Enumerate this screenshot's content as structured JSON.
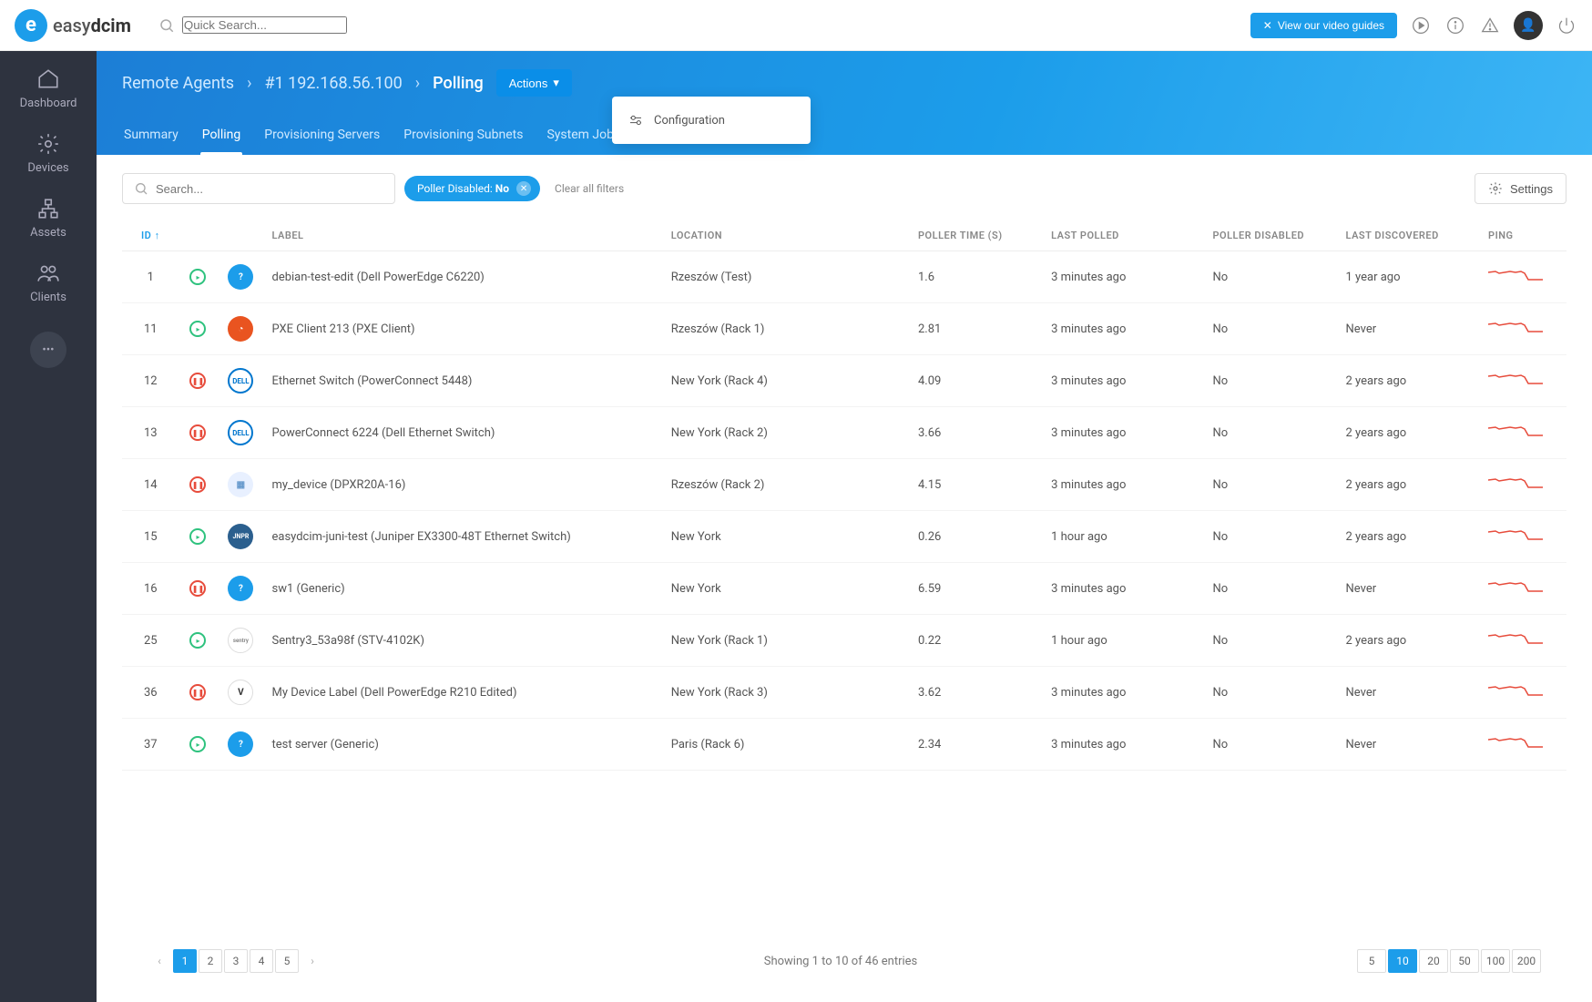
{
  "app": {
    "name": "easydcim"
  },
  "search_placeholder": "Quick Search...",
  "topbar": {
    "video_guides": "View our video guides"
  },
  "sidebar": {
    "items": [
      {
        "label": "Dashboard"
      },
      {
        "label": "Devices"
      },
      {
        "label": "Assets"
      },
      {
        "label": "Clients"
      }
    ]
  },
  "breadcrumb": {
    "items": [
      {
        "label": "Remote Agents"
      },
      {
        "label": "#1 192.168.56.100"
      },
      {
        "label": "Polling"
      }
    ],
    "actions_label": "Actions"
  },
  "tabs": [
    {
      "label": "Summary"
    },
    {
      "label": "Polling"
    },
    {
      "label": "Provisioning Servers"
    },
    {
      "label": "Provisioning Subnets"
    },
    {
      "label": "System Jobs"
    }
  ],
  "dropdown": {
    "configuration": "Configuration"
  },
  "toolbar": {
    "search_placeholder": "Search...",
    "filter_label": "Poller Disabled:",
    "filter_value": "No",
    "clear_label": "Clear all filters",
    "settings_label": "Settings"
  },
  "table": {
    "headers": {
      "id": "ID",
      "label": "LABEL",
      "location": "LOCATION",
      "poller_time": "POLLER TIME (S)",
      "last_polled": "LAST POLLED",
      "poller_disabled": "POLLER DISABLED",
      "last_discovered": "LAST DISCOVERED",
      "ping": "PING"
    },
    "rows": [
      {
        "id": "1",
        "status": "green",
        "logo": "q",
        "label": "debian-test-edit (Dell PowerEdge C6220)",
        "location": "Rzeszów (Test)",
        "ptime": "1.6",
        "polled": "3 minutes ago",
        "disabled": "No",
        "discovered": "1 year ago"
      },
      {
        "id": "11",
        "status": "green",
        "logo": "ubuntu",
        "label": "PXE Client 213 (PXE Client)",
        "location": "Rzeszów (Rack 1)",
        "ptime": "2.81",
        "polled": "3 minutes ago",
        "disabled": "No",
        "discovered": "Never"
      },
      {
        "id": "12",
        "status": "red",
        "logo": "dell",
        "label": "Ethernet Switch (PowerConnect 5448)",
        "location": "New York (Rack 4)",
        "ptime": "4.09",
        "polled": "3 minutes ago",
        "disabled": "No",
        "discovered": "2 years ago"
      },
      {
        "id": "13",
        "status": "red",
        "logo": "dell",
        "label": "PowerConnect 6224 (Dell Ethernet Switch)",
        "location": "New York (Rack 2)",
        "ptime": "3.66",
        "polled": "3 minutes ago",
        "disabled": "No",
        "discovered": "2 years ago"
      },
      {
        "id": "14",
        "status": "red",
        "logo": "pdu",
        "label": "my_device (DPXR20A-16)",
        "location": "Rzeszów (Rack 2)",
        "ptime": "4.15",
        "polled": "3 minutes ago",
        "disabled": "No",
        "discovered": "2 years ago"
      },
      {
        "id": "15",
        "status": "green",
        "logo": "juniper",
        "label": "easydcim-juni-test (Juniper EX3300-48T Ethernet Switch)",
        "location": "New York",
        "ptime": "0.26",
        "polled": "1 hour ago",
        "disabled": "No",
        "discovered": "2 years ago"
      },
      {
        "id": "16",
        "status": "red",
        "logo": "q",
        "label": "sw1 (Generic)",
        "location": "New York",
        "ptime": "6.59",
        "polled": "3 minutes ago",
        "disabled": "No",
        "discovered": "Never"
      },
      {
        "id": "25",
        "status": "green",
        "logo": "sentry",
        "label": "Sentry3_53a98f (STV-4102K)",
        "location": "New York (Rack 1)",
        "ptime": "0.22",
        "polled": "1 hour ago",
        "disabled": "No",
        "discovered": "2 years ago"
      },
      {
        "id": "36",
        "status": "red",
        "logo": "v",
        "label": "My Device Label (Dell PowerEdge R210 Edited)",
        "location": "New York (Rack 3)",
        "ptime": "3.62",
        "polled": "3 minutes ago",
        "disabled": "No",
        "discovered": "Never"
      },
      {
        "id": "37",
        "status": "green",
        "logo": "q",
        "label": "test server (Generic)",
        "location": "Paris (Rack 6)",
        "ptime": "2.34",
        "polled": "3 minutes ago",
        "disabled": "No",
        "discovered": "Never"
      }
    ]
  },
  "footer": {
    "summary": "Showing 1 to 10 of 46 entries",
    "pages": [
      "1",
      "2",
      "3",
      "4",
      "5"
    ],
    "page_sizes": [
      "5",
      "10",
      "20",
      "50",
      "100",
      "200"
    ],
    "active_page": "1",
    "active_size": "10"
  }
}
